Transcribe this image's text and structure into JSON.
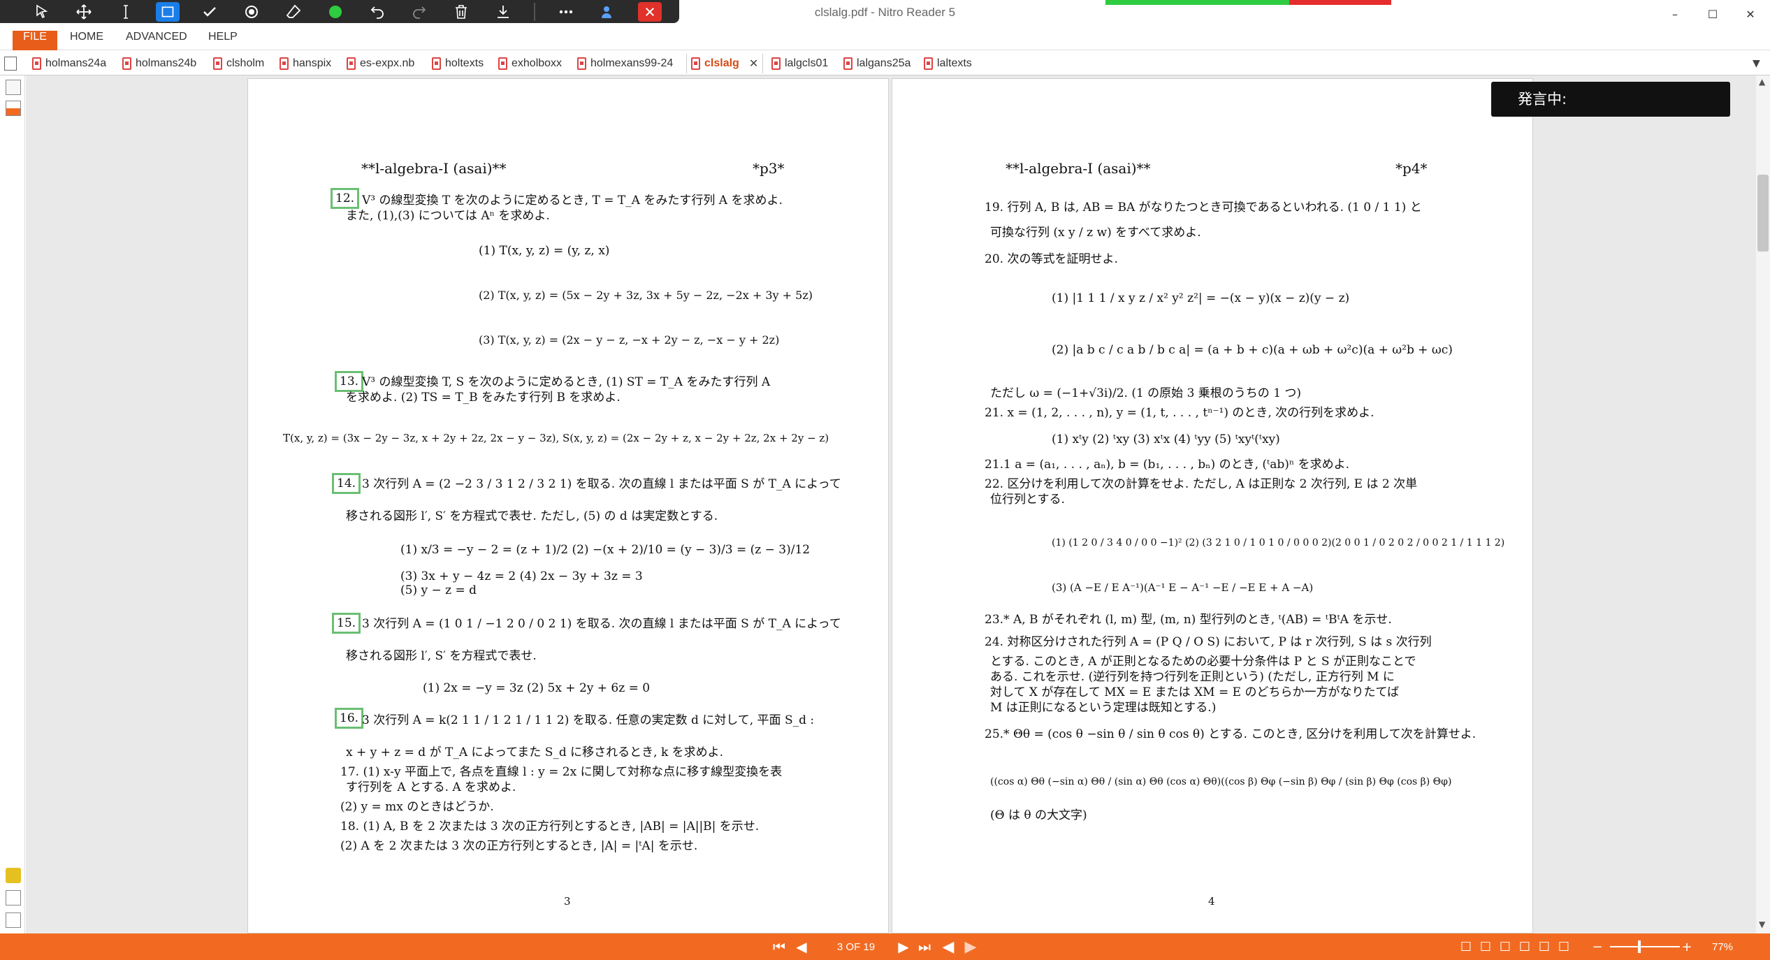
{
  "window": {
    "title": "clslalg.pdf - Nitro Reader 5",
    "minimize": "–",
    "maximize": "☐",
    "close": "✕"
  },
  "menu": {
    "file": "FILE",
    "home": "HOME",
    "advanced": "ADVANCED",
    "help": "HELP"
  },
  "tabs": [
    "holmans24a",
    "holmans24b",
    "clsholm",
    "hanspix",
    "es-expx.nb",
    "holtexts",
    "exholboxx",
    "holmexans99-24",
    "clslalg",
    "lalgcls01",
    "lalgans25a",
    "laltexts"
  ],
  "voice": {
    "label": "発言中:"
  },
  "page3": {
    "header_left": "**l-algebra-I (asai)**",
    "header_right": "*p3*",
    "lines": [
      "12.",
      "V³ の線型変換 T を次のように定めるとき, T = T_A をみたす行列 A を求めよ.",
      "また, (1),(3) については Aⁿ を求めよ.",
      "(1) T(x, y, z) = (y, z, x)",
      "(2) T(x, y, z) = (5x − 2y + 3z, 3x + 5y − 2z, −2x + 3y + 5z)",
      "(3) T(x, y, z) = (2x − y − z, −x + 2y − z, −x − y + 2z)",
      "13.",
      "V³ の線型変換 T, S を次のように定めるとき, (1) ST = T_A をみたす行列 A",
      "を求めよ. (2) TS = T_B をみたす行列 B を求めよ.",
      "T(x, y, z) = (3x − 2y − 3z, x + 2y + 2z, 2x − y − 3z),   S(x, y, z) = (2x − 2y + z, x − 2y + 2z, 2x + 2y − z)",
      "14.",
      "3 次行列 A = (2 −2 3 / 3 1 2 / 3 2 1) を取る. 次の直線 l または平面 S が T_A によって",
      "移される図形 l′, S′ を方程式で表せ. ただし, (5) の d は実定数とする.",
      "(1) x/3 = −y − 2 = (z + 1)/2      (2) −(x + 2)/10 = (y − 3)/3 = (z − 3)/12",
      "(3) 3x + y − 4z = 2      (4) 2x − 3y + 3z = 3",
      "(5) y − z = d",
      "15.",
      "3 次行列 A = (1 0 1 / −1 2 0 / 0 2 1) を取る. 次の直線 l または平面 S が T_A によって",
      "移される図形 l′, S′ を方程式で表せ.",
      "(1) 2x = −y = 3z      (2) 5x + 2y + 6z = 0",
      "16.",
      "3 次行列 A = k(2 1 1 / 1 2 1 / 1 1 2) を取る. 任意の実定数 d に対して, 平面 S_d :",
      "x + y + z = d が T_A によってまた S_d に移されるとき, k を求めよ.",
      "17. (1) x-y 平面上で, 各点を直線 l : y = 2x に関して対称な点に移す線型変換を表",
      "す行列を A とする. A を求めよ.",
      "(2) y = mx のときはどうか.",
      "18. (1) A, B を 2 次または 3 次の正方行列とするとき, |AB| = |A||B| を示せ.",
      "(2) A を 2 次または 3 次の正方行列とするとき, |A| = |ᵗA| を示せ."
    ],
    "page_number": "3"
  },
  "page4": {
    "header_left": "**l-algebra-I (asai)**",
    "header_right": "*p4*",
    "lines": [
      "19. 行列 A, B は, AB = BA がなりたつとき可換であるといわれる. (1 0 / 1 1) と",
      "可換な行列 (x y / z w) をすべて求めよ.",
      "20. 次の等式を証明せよ.",
      "(1) |1 1 1 / x y z / x² y² z²| = −(x − y)(x − z)(y − z)",
      "(2) |a b c / c a b / b c a| = (a + b + c)(a + ωb + ω²c)(a + ω²b + ωc)",
      "ただし ω = (−1+√3i)/2. (1 の原始 3 乗根のうちの 1 つ)",
      "21. x = (1, 2, . . . , n), y = (1, t, . . . , tⁿ⁻¹) のとき, 次の行列を求めよ.",
      "(1) xᵗy    (2) ᵗxy    (3) xᵗx    (4) ᵗyy    (5) ᵗxyᵗ(ᵗxy)",
      "21.1 a = (a₁, . . . , aₙ), b = (b₁, . . . , bₙ) のとき, (ᵗab)ⁿ を求めよ.",
      "22. 区分けを利用して次の計算をせよ. ただし, A は正則な 2 次行列, E は 2 次単",
      "位行列とする.",
      "(1) (1 2 0 / 3 4 0 / 0 0 −1)²      (2) (3 2 1 0 / 1 0 1 0 / 0 0 0 2)(2 0 0 1 / 0 2 0 2 / 0 0 2 1 / 1 1 1 2)",
      "(3) (A −E / E A⁻¹)(A⁻¹ E − A⁻¹ −E / −E E + A −A)",
      "23.* A, B がそれぞれ (l, m) 型, (m, n) 型行列のとき, ᵗ(AB) = ᵗBᵗA を示せ.",
      "24. 対称区分けされた行列 A = (P Q / O S) において, P は r 次行列, S は s 次行列",
      "とする. このとき, A が正則となるための必要十分条件は P と S が正則なことで",
      "ある. これを示せ. (逆行列を持つ行列を正則という) (ただし, 正方行列 M に",
      "対して X が存在して MX = E または XM = E のどちらか一方がなりたてば",
      "M は正則になるという定理は既知とする.)",
      "25.* Θθ = (cos θ −sin θ / sin θ cos θ) とする. このとき, 区分けを利用して次を計算せよ.",
      "((cos α) Θθ (−sin α) Θθ / (sin α) Θθ (cos α) Θθ)((cos β) Θφ (−sin β) Θφ / (sin β) Θφ (cos β) Θφ)",
      "(Θ は θ の大文字)"
    ],
    "page_number": "4"
  },
  "status": {
    "page_indicator": "3 OF 19",
    "zoom": "77%",
    "zoom_minus": "−",
    "zoom_plus": "+"
  },
  "colors": {
    "accent": "#f26a21",
    "file_tab": "#e85d1a",
    "box": "#6bbf73",
    "select": "#1a7de8",
    "close": "#e0312a"
  }
}
